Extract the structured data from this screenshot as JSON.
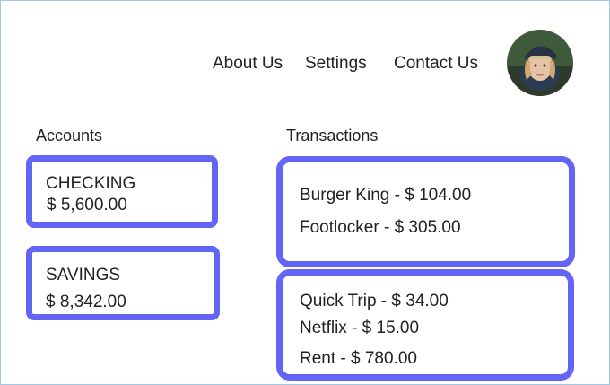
{
  "nav": {
    "about_label": "About Us",
    "settings_label": "Settings",
    "contact_label": "Contact Us"
  },
  "accounts": {
    "title": "Accounts",
    "items": [
      {
        "name": "CHECKING",
        "balance": "$ 5,600.00"
      },
      {
        "name": "SAVINGS",
        "balance": "$ 8,342.00"
      }
    ]
  },
  "transactions": {
    "title": "Transactions",
    "groups": [
      {
        "items": [
          "Burger King - $ 104.00",
          "Footlocker - $ 305.00"
        ]
      },
      {
        "items": [
          "Quick Trip - $ 34.00",
          "Netflix - $ 15.00",
          "Rent - $ 780.00"
        ]
      }
    ]
  },
  "colors": {
    "accent": "#6366f5",
    "frame_border": "#9ec9e8",
    "text": "#222222"
  },
  "icons": {
    "avatar": "user-avatar-photo"
  }
}
